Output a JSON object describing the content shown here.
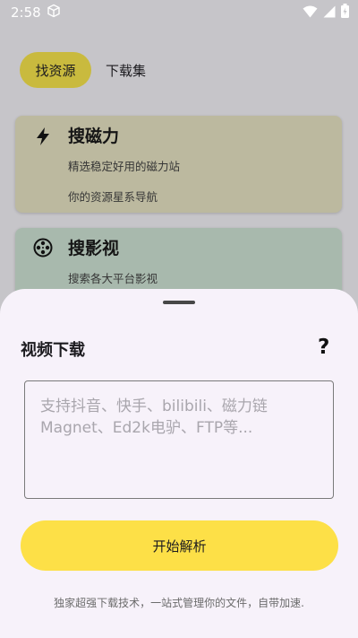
{
  "status_bar": {
    "time": "2:58",
    "icons": [
      "box-icon",
      "wifi-icon",
      "signal-icon",
      "battery-icon"
    ]
  },
  "tabs": [
    {
      "label": "找资源",
      "active": true
    },
    {
      "label": "下载集",
      "active": false
    }
  ],
  "cards": [
    {
      "title": "搜磁力",
      "icon": "lightning-icon",
      "lines": [
        "精选稳定好用的磁力站",
        "你的资源星系导航"
      ]
    },
    {
      "title": "搜影视",
      "icon": "film-reel-icon",
      "lines": [
        "搜索各大平台影视"
      ]
    }
  ],
  "sheet": {
    "title": "视频下载",
    "help_label": "?",
    "input_value": "",
    "input_placeholder": "支持抖音、快手、bilibili、磁力链Magnet、Ed2k电驴、FTP等...",
    "start_button": "开始解析",
    "footer_note": "独家超强下载技术，一站式管理你的文件，自带加速."
  },
  "colors": {
    "accent": "#fde047",
    "tab_active": "#c9ba3e",
    "card_magnet": "#bcb99f",
    "card_video": "#a8b9ad",
    "sheet_bg": "#f7f2fa"
  }
}
